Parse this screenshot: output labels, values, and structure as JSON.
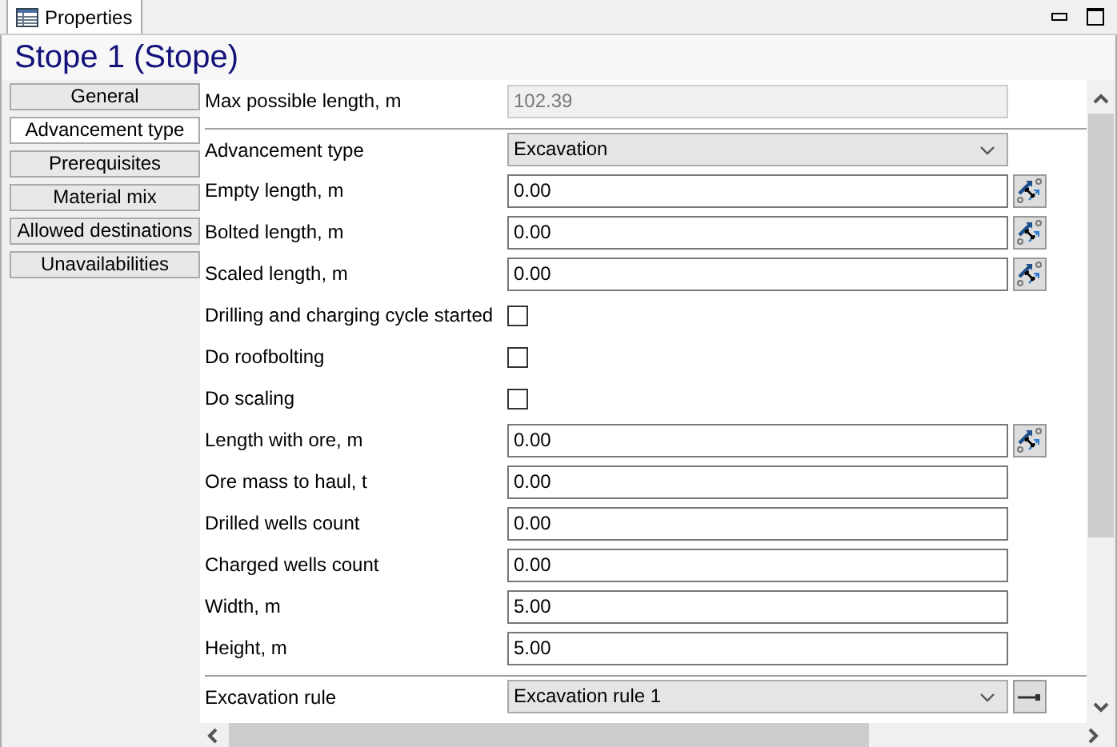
{
  "panel_tab": {
    "label": "Properties"
  },
  "title": "Stope 1 (Stope)",
  "nav": [
    {
      "label": "General",
      "selected": false
    },
    {
      "label": "Advancement type",
      "selected": true
    },
    {
      "label": "Prerequisites",
      "selected": false
    },
    {
      "label": "Material mix",
      "selected": false
    },
    {
      "label": "Allowed destinations",
      "selected": false
    },
    {
      "label": "Unavailabilities",
      "selected": false
    }
  ],
  "rows": [
    {
      "kind": "readonly",
      "label": "Max possible length, m",
      "value": "102.39"
    },
    {
      "kind": "select",
      "label": "Advancement type",
      "value": "Excavation",
      "separator_before": true
    },
    {
      "kind": "text",
      "label": "Empty length, m",
      "value": "0.00",
      "transform_button": true
    },
    {
      "kind": "text",
      "label": "Bolted length, m",
      "value": "0.00",
      "transform_button": true
    },
    {
      "kind": "text",
      "label": "Scaled length, m",
      "value": "0.00",
      "transform_button": true
    },
    {
      "kind": "checkbox",
      "label": "Drilling and charging cycle started",
      "checked": false
    },
    {
      "kind": "checkbox",
      "label": "Do roofbolting",
      "checked": false
    },
    {
      "kind": "checkbox",
      "label": "Do scaling",
      "checked": false
    },
    {
      "kind": "text",
      "label": "Length with ore, m",
      "value": "0.00",
      "transform_button": true
    },
    {
      "kind": "text",
      "label": "Ore mass to haul, t",
      "value": "0.00"
    },
    {
      "kind": "text",
      "label": "Drilled wells count",
      "value": "0.00"
    },
    {
      "kind": "text",
      "label": "Charged wells count",
      "value": "0.00"
    },
    {
      "kind": "text",
      "label": "Width, m",
      "value": "5.00"
    },
    {
      "kind": "text",
      "label": "Height, m",
      "value": "5.00"
    },
    {
      "kind": "select",
      "label": "Excavation rule",
      "value": "Excavation rule 1",
      "separator_before": true,
      "goto_button": true
    }
  ]
}
